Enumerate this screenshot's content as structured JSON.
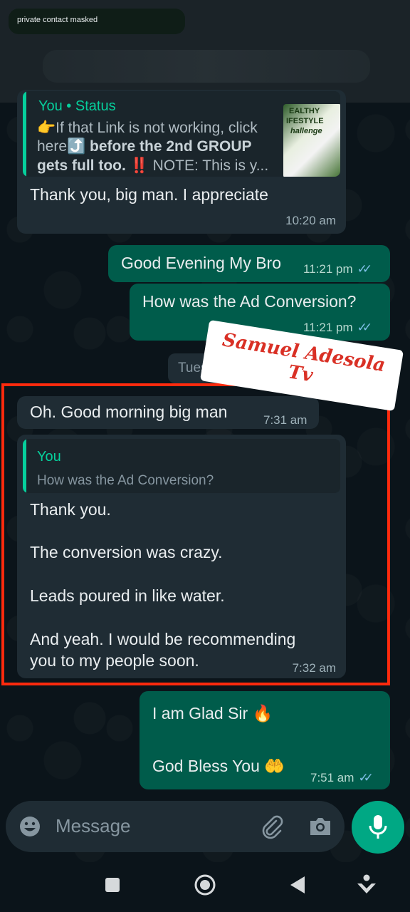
{
  "header": {
    "masked_label": "private contact masked"
  },
  "messages": {
    "status_reply": {
      "quote_name": "You • Status",
      "quote_line1": "👉If that Link is not working, click",
      "quote_line2_a": "here⤴️ ",
      "quote_line2_b": "before the 2nd GROUP",
      "quote_line3_a": "gets full too. ‼️",
      "quote_line3_b": " NOTE: This is y...",
      "thumb_text_1": "EALTHY",
      "thumb_text_2": "IFESTYLE",
      "thumb_text_3": "hallenge",
      "text": "Thank you, big man. I appreciate",
      "time": "10:20 am"
    },
    "out1": {
      "text": "Good Evening My Bro",
      "time": "11:21 pm"
    },
    "out2": {
      "text": "How was the Ad Conversion?",
      "time": "11:21 pm"
    },
    "date_chip": "Tues",
    "in1": {
      "text": "Oh. Good morning big man",
      "time": "7:31 am"
    },
    "in2": {
      "quote_name": "You",
      "quote_text": "How was the Ad Conversion?",
      "line1": "Thank you.",
      "line2": "The conversion was crazy.",
      "line3": "Leads poured in like water.",
      "line4": "And yeah. I would be recommending",
      "line5": "you to my people soon.",
      "time": "7:32 am"
    },
    "out3": {
      "line1": "I am Glad Sir 🔥",
      "line2": "God Bless You 🤲",
      "time": "7:51 am"
    }
  },
  "watermark": {
    "line1": "Samuel Adesola",
    "line2": "Tv"
  },
  "composer": {
    "placeholder": "Message"
  },
  "colors": {
    "accent": "#00a884",
    "outgoing": "#005c4b",
    "incoming": "#1f2c34",
    "highlight": "#ff2a0d"
  }
}
